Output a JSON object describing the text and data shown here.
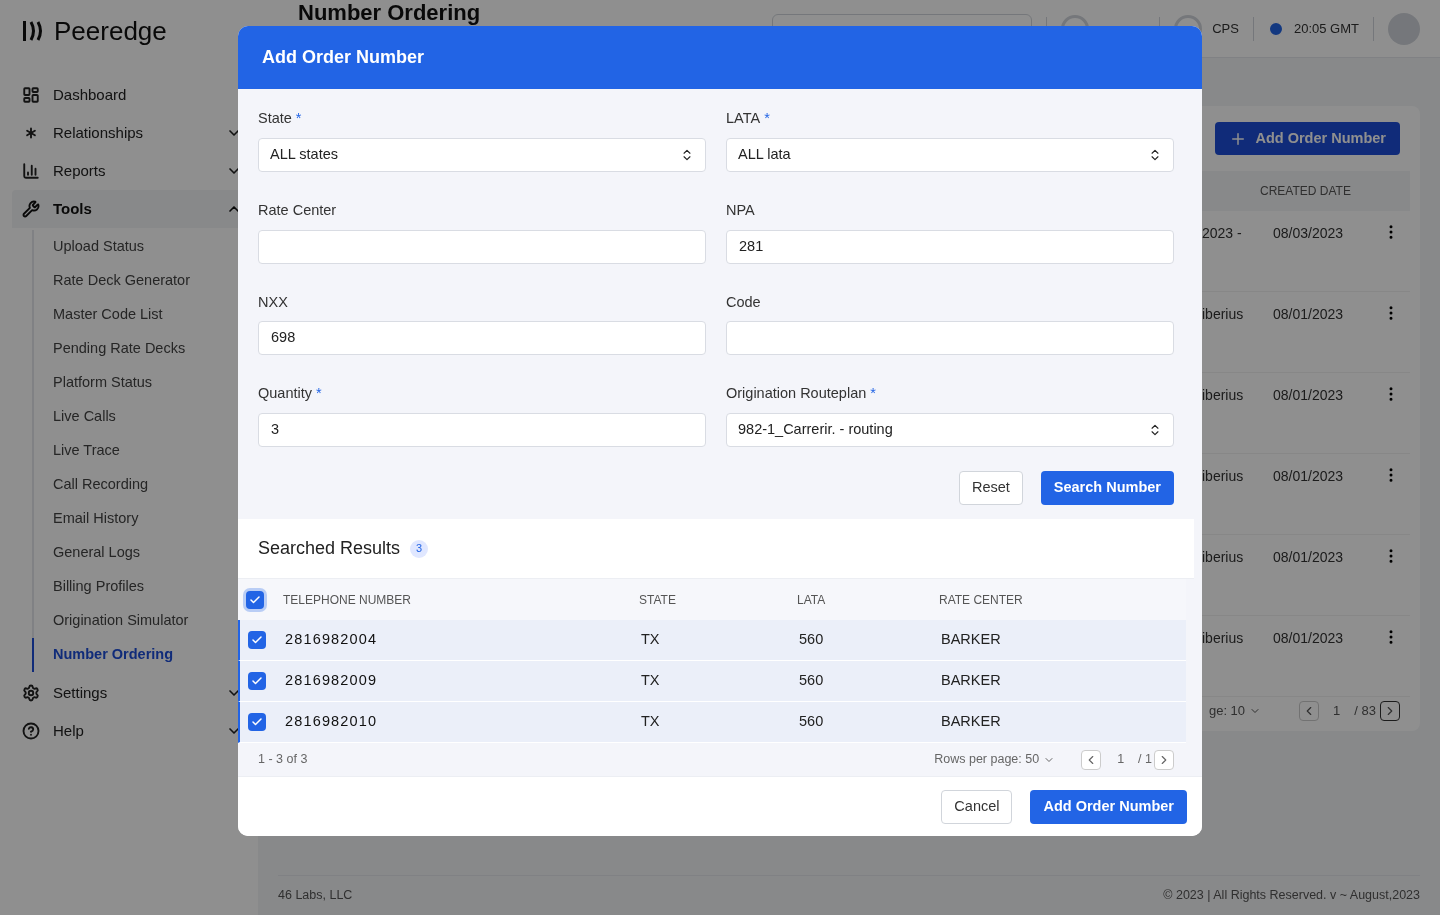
{
  "app": {
    "logo": "Peeredge",
    "page_title": "Number Ordering",
    "header": {
      "metric_label": "CPS",
      "time": "20:05 GMT"
    }
  },
  "sidebar": {
    "items": [
      {
        "label": "Dashboard",
        "kind": "link"
      },
      {
        "label": "Relationships",
        "kind": "group",
        "expanded": false
      },
      {
        "label": "Reports",
        "kind": "group",
        "expanded": false
      },
      {
        "label": "Tools",
        "kind": "group",
        "expanded": true,
        "children": [
          {
            "label": "Upload Status",
            "selected": false
          },
          {
            "label": "Rate Deck Generator",
            "selected": false
          },
          {
            "label": "Master Code List",
            "selected": false
          },
          {
            "label": "Pending Rate Decks",
            "selected": false
          },
          {
            "label": "Platform Status",
            "selected": false
          },
          {
            "label": "Live Calls",
            "selected": false
          },
          {
            "label": "Live Trace",
            "selected": false
          },
          {
            "label": "Call Recording",
            "selected": false
          },
          {
            "label": "Email History",
            "selected": false
          },
          {
            "label": "General Logs",
            "selected": false
          },
          {
            "label": "Billing Profiles",
            "selected": false
          },
          {
            "label": "Origination Simulator",
            "selected": false
          },
          {
            "label": "Number Ordering",
            "selected": true
          }
        ]
      },
      {
        "label": "Settings",
        "kind": "group",
        "expanded": false
      },
      {
        "label": "Help",
        "kind": "group",
        "expanded": false
      }
    ]
  },
  "background_page": {
    "add_button": "Add Order Number",
    "column": "CREATED DATE",
    "rows": [
      {
        "column_1": "2023 -",
        "created_date": "08/03/2023"
      },
      {
        "column_1": "iberius",
        "created_date": "08/01/2023"
      },
      {
        "column_1": "iberius",
        "created_date": "08/01/2023"
      },
      {
        "column_1": "iberius",
        "created_date": "08/01/2023"
      },
      {
        "column_1": "iberius",
        "created_date": "08/01/2023"
      },
      {
        "column_1": "iberius",
        "created_date": "08/01/2023"
      }
    ],
    "pagination": {
      "rows_per_page": "ge: 10",
      "page": "1",
      "total": "/ 83"
    }
  },
  "footer": {
    "left": "46 Labs, LLC",
    "right": "© 2023 | All Rights Reserved. v ~ August,2023"
  },
  "modal": {
    "title": "Add Order Number",
    "fields": [
      {
        "label": "State",
        "required_mark": "*",
        "kind": "select",
        "value": "ALL states"
      },
      {
        "label": "LATA",
        "required_mark": "*",
        "kind": "select",
        "value": "ALL lata"
      },
      {
        "label": "Rate Center",
        "kind": "input"
      },
      {
        "label": "NPA",
        "kind": "input",
        "value": "281"
      },
      {
        "label": "NXX",
        "kind": "input",
        "value": "698"
      },
      {
        "label": "Code",
        "kind": "input"
      },
      {
        "label": "Quantity",
        "required_mark": "*",
        "kind": "input",
        "value": "3"
      },
      {
        "label": "Origination Routeplan",
        "required_mark": "*",
        "kind": "select",
        "value": "982-1_Carrerir. - routing"
      }
    ],
    "reset_button": "Reset",
    "search_button": "Search Number",
    "results": {
      "title": "Searched Results",
      "count": "3",
      "all_checked": true,
      "columns": [
        "TELEPHONE NUMBER",
        "STATE",
        "LATA",
        "RATE CENTER"
      ],
      "rows": [
        {
          "telephone_number": "2816982004",
          "state": "TX",
          "lata": "560",
          "rate_center": "BARKER",
          "checked": true
        },
        {
          "telephone_number": "2816982009",
          "state": "TX",
          "lata": "560",
          "rate_center": "BARKER",
          "checked": true
        },
        {
          "telephone_number": "2816982010",
          "state": "TX",
          "lata": "560",
          "rate_center": "BARKER",
          "checked": true
        }
      ],
      "range": "1 - 3 of 3",
      "rows_per_page": "Rows per page: 50",
      "page": "1",
      "total": "/ 1"
    },
    "cancel_button": "Cancel",
    "submit_button": "Add Order Number"
  }
}
